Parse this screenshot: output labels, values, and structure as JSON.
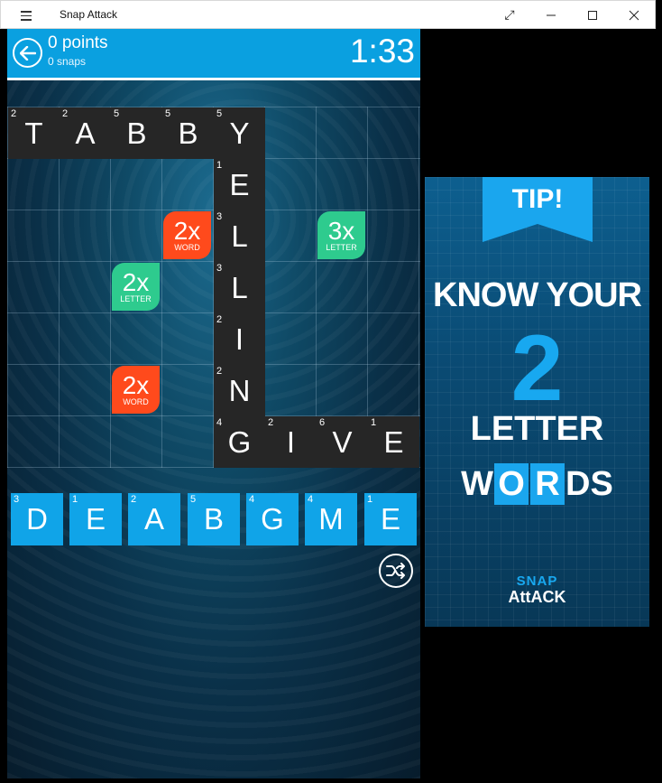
{
  "window": {
    "title": "Snap Attack",
    "buttons": [
      "expand",
      "minimize",
      "maximize",
      "close"
    ]
  },
  "header": {
    "points": "0 points",
    "snaps": "0 snaps",
    "timer": "1:33"
  },
  "board": {
    "tiles": [
      {
        "letter": "T",
        "points": "2"
      },
      {
        "letter": "A",
        "points": "2"
      },
      {
        "letter": "B",
        "points": "5"
      },
      {
        "letter": "B",
        "points": "5"
      },
      {
        "letter": "Y",
        "points": "5"
      },
      {
        "letter": "E",
        "points": "1"
      },
      {
        "letter": "L",
        "points": "3"
      },
      {
        "letter": "L",
        "points": "3"
      },
      {
        "letter": "I",
        "points": "2"
      },
      {
        "letter": "N",
        "points": "2"
      },
      {
        "letter": "G",
        "points": "4"
      },
      {
        "letter": "I",
        "points": "2"
      },
      {
        "letter": "V",
        "points": "6"
      },
      {
        "letter": "E",
        "points": "1"
      }
    ],
    "bonuses": [
      {
        "multiplier": "2x",
        "kind": "WORD"
      },
      {
        "multiplier": "3x",
        "kind": "LETTER"
      },
      {
        "multiplier": "2x",
        "kind": "LETTER"
      },
      {
        "multiplier": "2x",
        "kind": "WORD"
      }
    ]
  },
  "rack": [
    {
      "letter": "D",
      "points": "3"
    },
    {
      "letter": "E",
      "points": "1"
    },
    {
      "letter": "A",
      "points": "2"
    },
    {
      "letter": "B",
      "points": "5"
    },
    {
      "letter": "G",
      "points": "4"
    },
    {
      "letter": "M",
      "points": "4"
    },
    {
      "letter": "E",
      "points": "1"
    }
  ],
  "ad": {
    "tip": "TIP!",
    "line1": "KNOW YOUR",
    "number": "2",
    "line3": "LETTER",
    "line4_pre": "W",
    "line4_tile1": "O",
    "line4_tile2": "R",
    "line4_post": "DS",
    "logo_top": "SNAP",
    "logo_bottom": "AttACK"
  },
  "colors": {
    "header": "#0aa0e0",
    "board_tile": "#262626",
    "rack_tile": "#10a4e8",
    "bonus_word": "#ff4a1c",
    "bonus_letter": "#2ecb8e"
  }
}
